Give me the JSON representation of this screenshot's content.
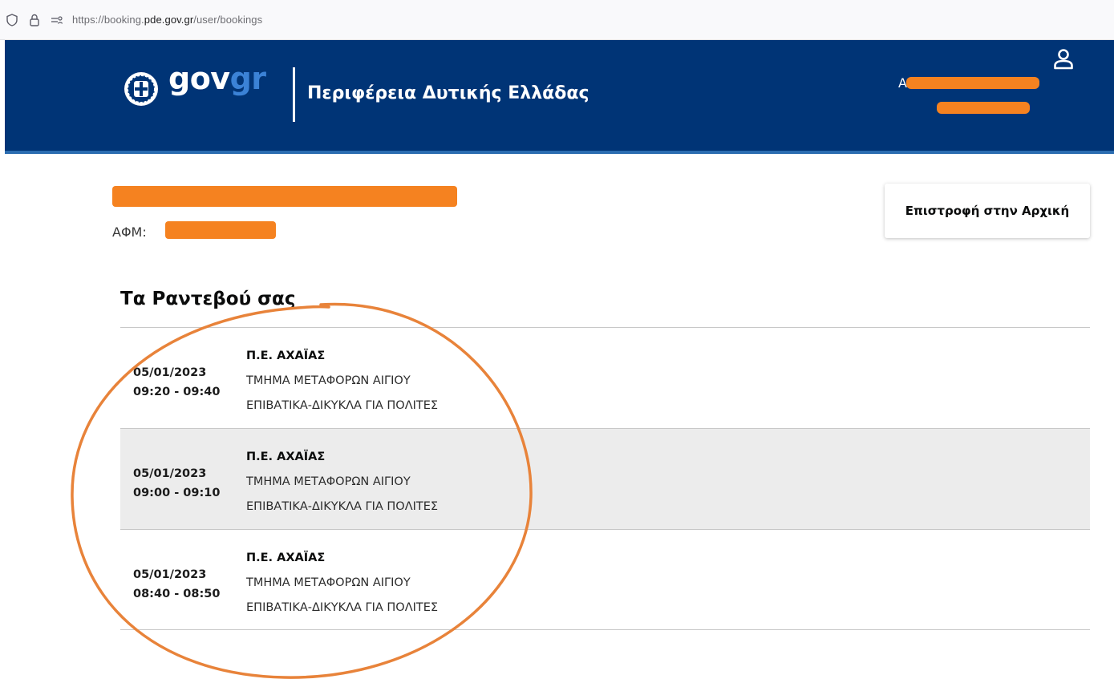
{
  "browser": {
    "url_prefix": "https://booking.",
    "url_domain": "pde.gov.gr",
    "url_path": "/user/bookings"
  },
  "header": {
    "logo_gov": "gov",
    "logo_gr": "gr",
    "title": "Περιφέρεια Δυτικής Ελλάδας",
    "user_initial": "A",
    "background_color": "#003476"
  },
  "profile": {
    "afm_label": "ΑΦΜ:"
  },
  "actions": {
    "back_label": "Επιστροφή στην Αρχική"
  },
  "bookings_section": {
    "title": "Τα Ραντεβού σας",
    "items": [
      {
        "date": "05/01/2023",
        "time": "09:20 - 09:40",
        "region": "Π.Ε. ΑΧΑΪΑΣ",
        "department": "ΤΜΗΜΑ ΜΕΤΑΦΟΡΩΝ ΑΙΓΙΟΥ",
        "service": "ΕΠΙΒΑΤΙΚΑ-ΔΙΚΥΚΛΑ ΓΙΑ ΠΟΛΙΤΕΣ"
      },
      {
        "date": "05/01/2023",
        "time": "09:00 - 09:10",
        "region": "Π.Ε. ΑΧΑΪΑΣ",
        "department": "ΤΜΗΜΑ ΜΕΤΑΦΟΡΩΝ ΑΙΓΙΟΥ",
        "service": "ΕΠΙΒΑΤΙΚΑ-ΔΙΚΥΚΛΑ ΓΙΑ ΠΟΛΙΤΕΣ"
      },
      {
        "date": "05/01/2023",
        "time": "08:40 - 08:50",
        "region": "Π.Ε. ΑΧΑΪΑΣ",
        "department": "ΤΜΗΜΑ ΜΕΤΑΦΟΡΩΝ ΑΙΓΙΟΥ",
        "service": "ΕΠΙΒΑΤΙΚΑ-ΔΙΚΥΚΛΑ ΓΙΑ ΠΟΛΙΤΕΣ"
      }
    ]
  },
  "colors": {
    "redaction": "#f58220",
    "annotation": "#e8833a",
    "accent_blue": "#3b82d6"
  },
  "icons": [
    "shield-icon",
    "lock-icon",
    "permissions-icon",
    "govgr-emblem-icon",
    "user-icon"
  ]
}
